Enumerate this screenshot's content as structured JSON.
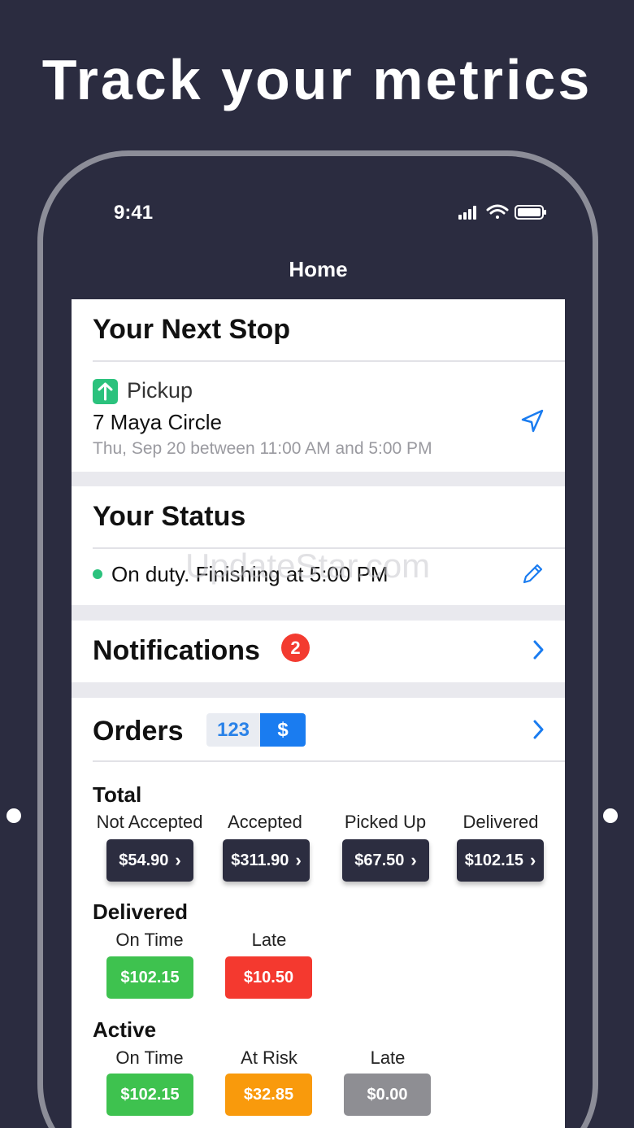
{
  "headline": "Track your metrics",
  "status_bar": {
    "time": "9:41"
  },
  "nav": {
    "title": "Home"
  },
  "next_stop": {
    "title": "Your Next Stop",
    "type": "Pickup",
    "address": "7 Maya Circle",
    "window": "Thu, Sep 20 between 11:00 AM and 5:00 PM"
  },
  "status": {
    "title": "Your Status",
    "text": "On duty. Finishing at 5:00 PM",
    "dot_color": "#2bc27d"
  },
  "notifications": {
    "title": "Notifications",
    "count": "2"
  },
  "orders": {
    "title": "Orders",
    "toggle": {
      "count_label": "123",
      "money_label": "$",
      "selected": "$"
    },
    "total": {
      "title": "Total",
      "columns": [
        {
          "label": "Not Accepted",
          "value": "$54.90"
        },
        {
          "label": "Accepted",
          "value": "$311.90"
        },
        {
          "label": "Picked Up",
          "value": "$67.50"
        },
        {
          "label": "Delivered",
          "value": "$102.15"
        }
      ]
    },
    "delivered": {
      "title": "Delivered",
      "columns": [
        {
          "label": "On Time",
          "value": "$102.15",
          "color": "#3ec24f"
        },
        {
          "label": "Late",
          "value": "$10.50",
          "color": "#f4392f"
        }
      ]
    },
    "active": {
      "title": "Active",
      "columns": [
        {
          "label": "On Time",
          "value": "$102.15",
          "color": "#3ec24f"
        },
        {
          "label": "At Risk",
          "value": "$32.85",
          "color": "#f99a0c"
        },
        {
          "label": "Late",
          "value": "$0.00",
          "color": "#8e8e93"
        }
      ]
    }
  },
  "watermark": "UpdateStar.com",
  "colors": {
    "background": "#2b2c40",
    "accent": "#1a7cf0"
  }
}
